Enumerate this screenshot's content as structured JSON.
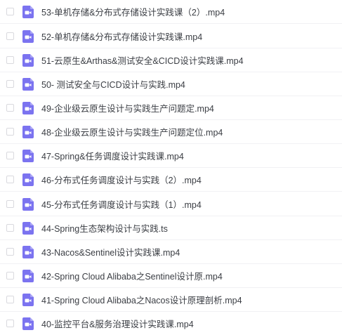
{
  "files": [
    {
      "name": "53-单机存储&分布式存储设计实践课（2）.mp4",
      "icon": "video-file-icon"
    },
    {
      "name": "52-单机存储&分布式存储设计实践课.mp4",
      "icon": "video-file-icon"
    },
    {
      "name": "51-云原生&Arthas&测试安全&CICD设计实践课.mp4",
      "icon": "video-file-icon"
    },
    {
      "name": "50- 测试安全与CICD设计与实践.mp4",
      "icon": "video-file-icon"
    },
    {
      "name": "49-企业级云原生设计与实践生产问题定.mp4",
      "icon": "video-file-icon"
    },
    {
      "name": "48-企业级云原生设计与实践生产问题定位.mp4",
      "icon": "video-file-icon"
    },
    {
      "name": "47-Spring&任务调度设计实践课.mp4",
      "icon": "video-file-icon"
    },
    {
      "name": "46-分布式任务调度设计与实践（2）.mp4",
      "icon": "video-file-icon"
    },
    {
      "name": "45-分布式任务调度设计与实践（1）.mp4",
      "icon": "video-file-icon"
    },
    {
      "name": "44-Spring生态架构设计与实践.ts",
      "icon": "video-file-icon"
    },
    {
      "name": "43-Nacos&Sentinel设计实践课.mp4",
      "icon": "video-file-icon"
    },
    {
      "name": "42-Spring Cloud Alibaba之Sentinel设计原.mp4",
      "icon": "video-file-icon"
    },
    {
      "name": "41-Spring Cloud Alibaba之Nacos设计原理剖析.mp4",
      "icon": "video-file-icon"
    },
    {
      "name": "40-监控平台&服务治理设计实践课.mp4",
      "icon": "video-file-icon"
    }
  ],
  "colors": {
    "icon": "#7b73f0",
    "text": "#3b3e44"
  }
}
